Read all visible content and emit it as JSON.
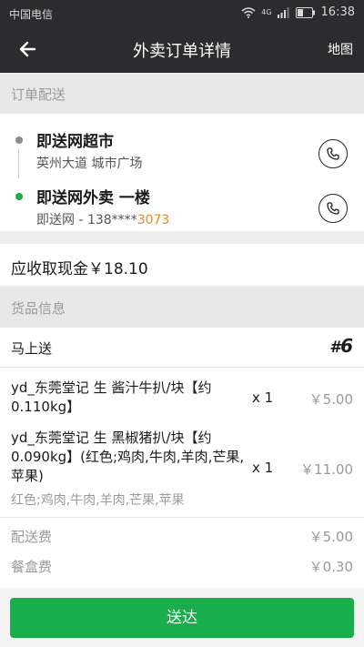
{
  "status_bar": {
    "carrier": "中国电信",
    "network": "4G",
    "time": "16:38",
    "icons": [
      "wifi-icon",
      "signal-icon",
      "battery-icon"
    ]
  },
  "nav": {
    "back_icon": "back-arrow-icon",
    "title": "外卖订单详情",
    "map_label": "地图"
  },
  "delivery_section": {
    "header": "订单配送",
    "from": {
      "name": "即送网超市",
      "address": "英州大道 城市广场",
      "dot_color": "#8a8a8a",
      "icon": "phone-icon"
    },
    "to": {
      "name": "即送网外卖 一楼",
      "contact_prefix": "即送网 - 138****",
      "contact_highlight": "3073",
      "dot_color": "#1aad4b",
      "icon": "phone-icon"
    }
  },
  "cash": {
    "label": "应收取现金￥18.10"
  },
  "goods_section": {
    "header": "货品信息",
    "mode_label": "马上送",
    "order_hash": "#",
    "order_number": "6",
    "items": [
      {
        "name": "yd_东莞堂记 生 酱汁牛扒/块【约0.110kg】",
        "qty": "x 1",
        "price": "￥5.00",
        "spec": ""
      },
      {
        "name": "yd_东莞堂记 生 黑椒猪扒/块【约0.090kg】(红色;鸡肉,牛肉,羊肉,芒果,苹果)",
        "qty": "x 1",
        "price": "￥11.00",
        "spec": "红色;鸡肉,牛肉,羊肉,芒果,苹果"
      }
    ],
    "fees": [
      {
        "label": "配送费",
        "value": "￥5.00"
      },
      {
        "label": "餐盒费",
        "value": "￥0.30"
      }
    ]
  },
  "action": {
    "deliver_label": "送达",
    "color": "#1aad4b"
  }
}
